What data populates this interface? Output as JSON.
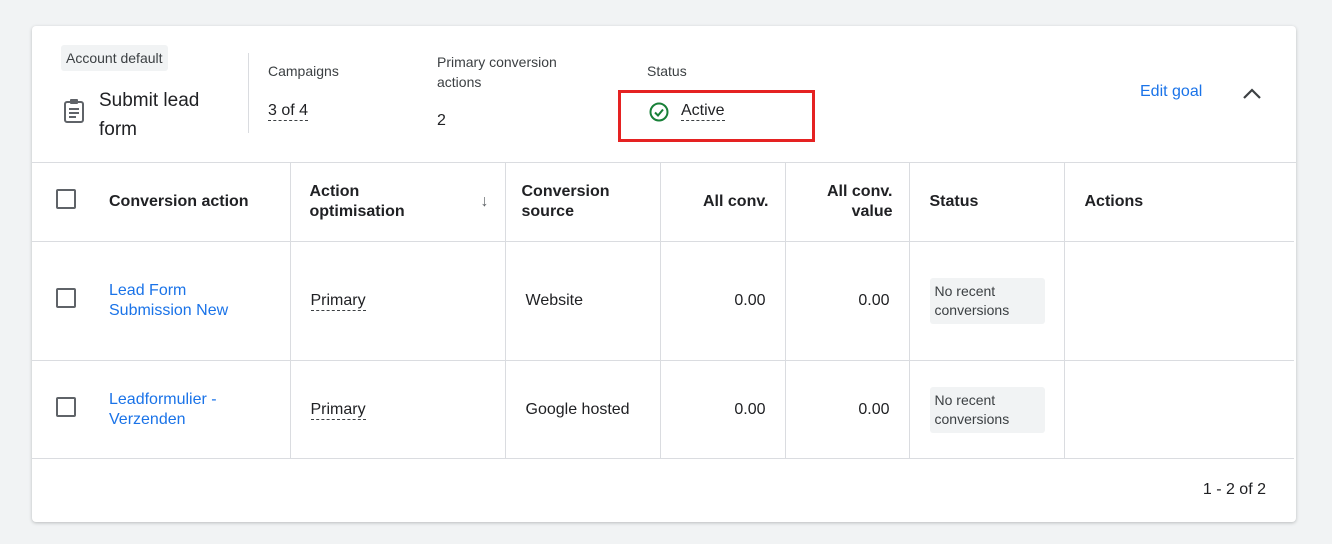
{
  "goal": {
    "badge": "Account default",
    "title": "Submit lead form",
    "icon": "clipboard-icon",
    "campaigns_label": "Campaigns",
    "campaigns_value": "3 of 4",
    "primary_label": "Primary conversion actions",
    "primary_value": "2",
    "status_label": "Status",
    "status_value": "Active",
    "edit_label": "Edit goal"
  },
  "table": {
    "headers": [
      "Conversion action",
      "Action optimisation",
      "Conversion source",
      "All conv.",
      "All conv. value",
      "Status",
      "Actions"
    ],
    "rows": [
      {
        "name": "Lead Form Submission New",
        "optimisation": "Primary",
        "source": "Website",
        "all_conv": "0.00",
        "value": "0.00",
        "status": "No recent conversions"
      },
      {
        "name": "Leadformulier - Verzenden",
        "optimisation": "Primary",
        "source": "Google hosted",
        "all_conv": "0.00",
        "value": "0.00",
        "status": "No recent conversions"
      }
    ]
  },
  "pagination": "1 - 2 of 2",
  "colors": {
    "accent": "#1a73e8",
    "success": "#188038",
    "highlight": "#e52222"
  }
}
